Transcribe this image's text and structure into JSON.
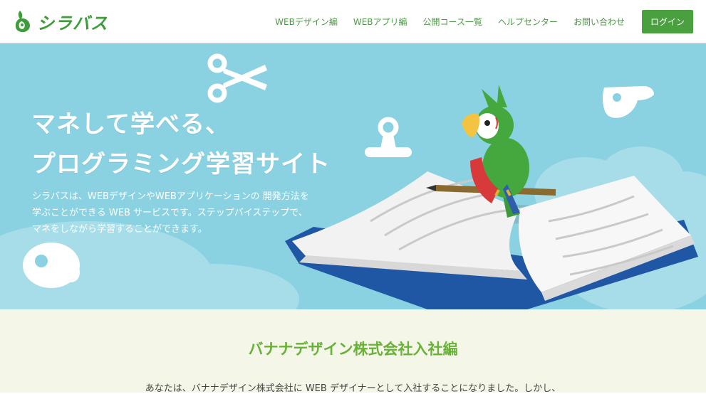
{
  "header": {
    "logo_text": "シラバス",
    "nav": [
      {
        "label": "WEBデザイン編"
      },
      {
        "label": "WEBアプリ編"
      },
      {
        "label": "公開コース一覧"
      },
      {
        "label": "ヘルプセンター"
      },
      {
        "label": "お問い合わせ"
      }
    ],
    "login_label": "ログイン"
  },
  "hero": {
    "title_line1": "マネして学べる、",
    "title_line2": "プログラミング学習サイト",
    "desc_line1": "シラバスは、WEBデザインやWEBアプリケーションの 開発方法を",
    "desc_line2": "学ぶことができる WEB サービスです。ステップバイステップで、",
    "desc_line3": "マネをしながら学習することができます。"
  },
  "section": {
    "title": "バナナデザイン株式会社入社編",
    "text": "あなたは、バナナデザイン株式会社に WEB デザイナーとして入社することになりました。しかし、"
  },
  "colors": {
    "brand_green": "#3e9d3a",
    "hero_bg": "#8ad2e2",
    "section_bg": "#f4f6e7",
    "book_blue": "#1f57a5"
  }
}
